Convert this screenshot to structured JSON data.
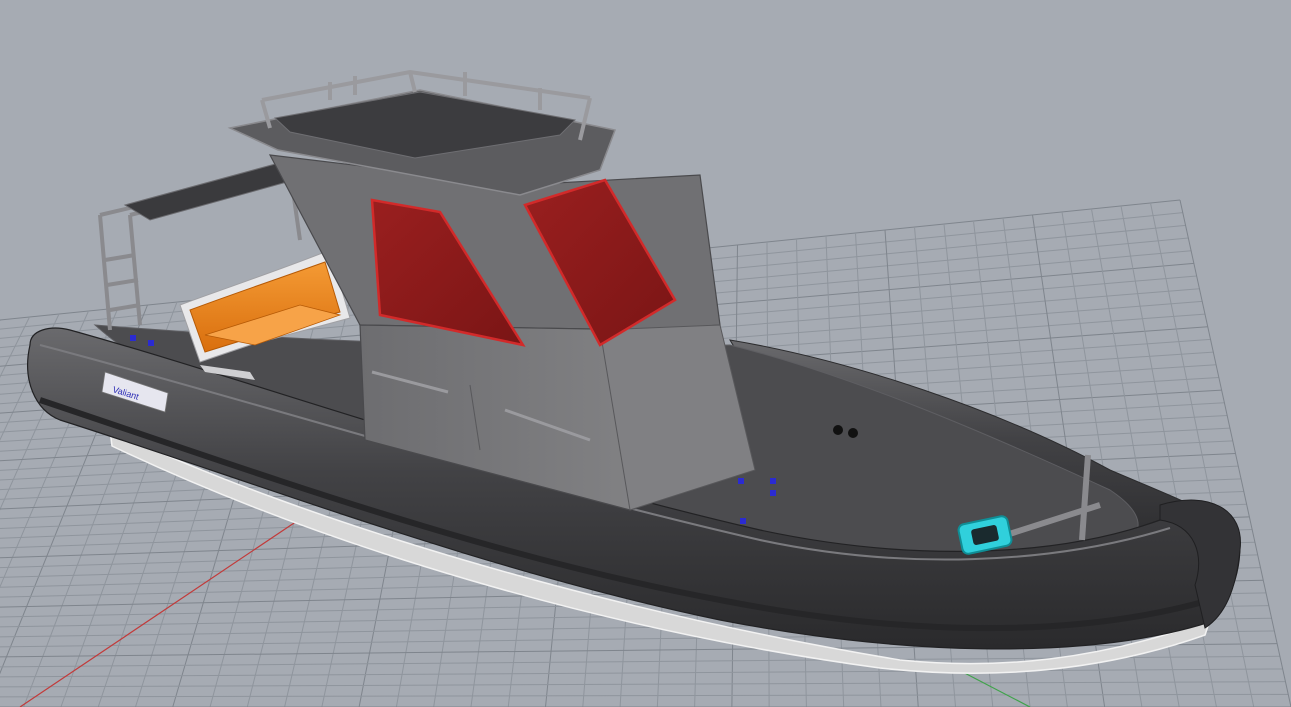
{
  "viewport": {
    "name": "perspective-viewport",
    "background": "#a6abb3",
    "grid_color": "#8f959d",
    "grid_major_color": "#7f858d",
    "x_axis_color": "#c23a3a",
    "y_axis_color": "#3fa34a"
  },
  "model": {
    "hull_color": "#4a4a4c",
    "tube_color": "#3f3f42",
    "console_color": "#7a7a7c",
    "window_color": "#8e1d1d",
    "window_frame_color": "#cf2727",
    "seat_color": "#f0861a",
    "hatch_color": "#2fd6e0",
    "logo_text": "Valiant"
  }
}
